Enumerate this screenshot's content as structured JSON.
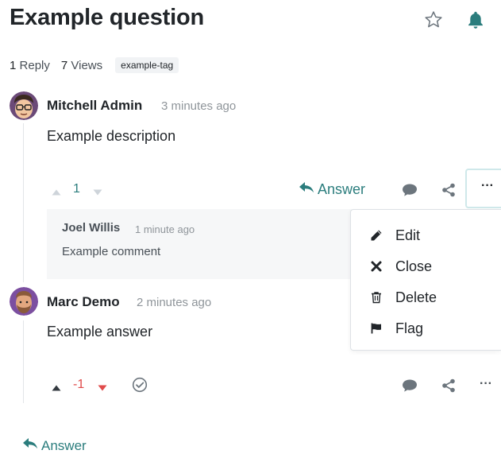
{
  "question": {
    "title": "Example question",
    "stats": {
      "replies_num": "1",
      "replies_label": "Reply",
      "views_num": "7",
      "views_label": "Views"
    },
    "tag": "example-tag",
    "author": "Mitchell Admin",
    "time": "3 minutes ago",
    "body": "Example description",
    "vote_count": "1",
    "answer_label": "Answer"
  },
  "comment": {
    "author": "Joel Willis",
    "time": "1 minute ago",
    "text": "Example comment"
  },
  "dropdown": {
    "items": [
      {
        "label": "Edit",
        "icon": "pencil-icon"
      },
      {
        "label": "Close",
        "icon": "close-icon"
      },
      {
        "label": "Delete",
        "icon": "trash-icon"
      },
      {
        "label": "Flag",
        "icon": "flag-icon"
      }
    ]
  },
  "answer": {
    "author": "Marc Demo",
    "time": "2 minutes ago",
    "body": "Example answer",
    "vote_count": "-1"
  },
  "footer": {
    "answer_label": "Answer"
  },
  "more_label": "···",
  "colors": {
    "accent": "#2b7d7d",
    "negative": "#e04a4a",
    "muted": "#8f959a",
    "icon": "#495057"
  }
}
